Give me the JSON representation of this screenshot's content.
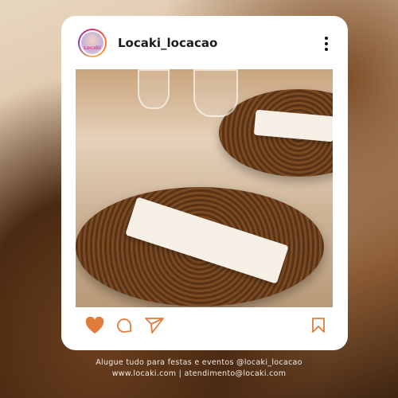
{
  "post": {
    "username": "Locaki_locacao",
    "avatar_text": "Locaki",
    "accent_color": "#e07b39"
  },
  "icons": [
    "heart-icon",
    "comment-icon",
    "share-icon",
    "bookmark-icon",
    "more-icon"
  ],
  "footer": {
    "line1": "Alugue tudo para festas e eventos @locaki_locacao",
    "line2": "www.locaki.com | atendimento@locaki.com"
  }
}
